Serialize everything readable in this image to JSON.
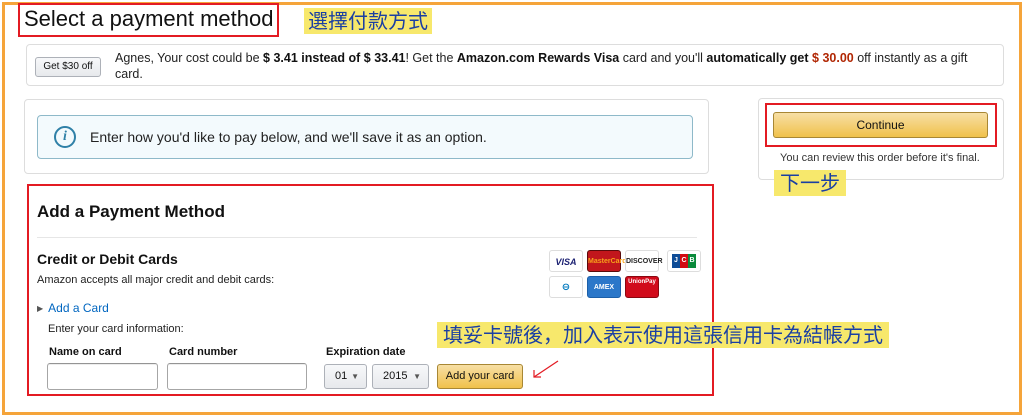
{
  "page": {
    "title": "Select a payment method"
  },
  "annotations": {
    "title_note": "選擇付款方式",
    "next_note": "下一步",
    "card_note": "填妥卡號後，加入表示使用這張信用卡為結帳方式"
  },
  "promo": {
    "button_label": "Get $30 off",
    "text_1": "Agnes, Your cost could be ",
    "text_bold_1": "$ 3.41 instead of $ 33.41",
    "text_2": "! Get the ",
    "text_bold_2": "Amazon.com Rewards Visa",
    "text_3": " card and you'll ",
    "text_bold_3": "automatically get",
    "text_price": " $ 30.00",
    "text_4": " off instantly as a gift card."
  },
  "info": {
    "icon": "info-icon",
    "message": "Enter how you'd like to pay below, and we'll save it as an option."
  },
  "checkout": {
    "continue_label": "Continue",
    "review_note": "You can review this order before it's final."
  },
  "payment_method": {
    "title": "Add a Payment Method",
    "section_title": "Credit or Debit Cards",
    "section_subtitle": "Amazon accepts all major credit and debit cards:",
    "add_card_link": "Add a Card",
    "enter_info": "Enter your card information:",
    "name_label": "Name on card",
    "name_value": "",
    "number_label": "Card number",
    "number_value": "",
    "expiration_label": "Expiration date",
    "month_value": "01",
    "year_value": "2015",
    "add_card_button": "Add your card",
    "card_logos": [
      "VISA",
      "MasterCard",
      "DISCOVER",
      "JCB",
      "Diners Club",
      "AMEX",
      "UnionPay"
    ]
  },
  "colors": {
    "highlight_border": "#e31b23",
    "frame_border": "#f5a43a",
    "note_background": "#f7e86c",
    "note_text": "#1a3fa3",
    "primary_button": "#f0c14b",
    "link": "#0066c0",
    "price": "#b12704"
  }
}
